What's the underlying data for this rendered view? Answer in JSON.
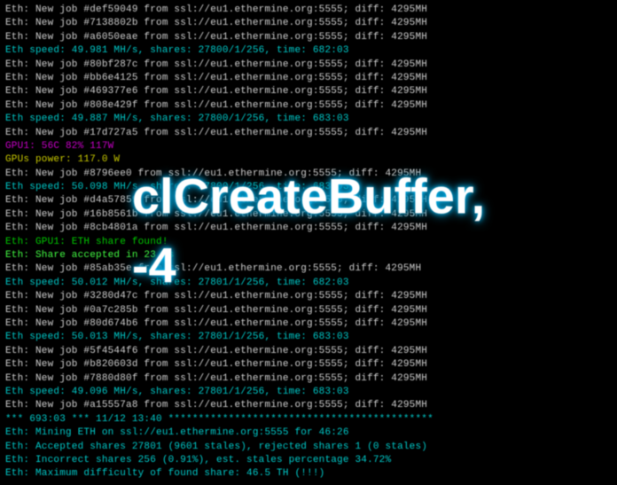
{
  "overlay_text": "clCreateBuffer, -4",
  "lines": [
    {
      "cls": "white",
      "text": "Eth: New job #def59049 from ssl://eu1.ethermine.org:5555; diff: 4295MH"
    },
    {
      "cls": "white",
      "text": "Eth: New job #7138802b from ssl://eu1.ethermine.org:5555; diff: 4295MH"
    },
    {
      "cls": "white",
      "text": "Eth: New job #a6050eae from ssl://eu1.ethermine.org:5555; diff: 4295MH"
    },
    {
      "cls": "cyan",
      "text": "Eth speed: 49.981 MH/s, shares: 27800/1/256, time: 682:03"
    },
    {
      "cls": "white",
      "text": "Eth: New job #80bf287c from ssl://eu1.ethermine.org:5555; diff: 4295MH"
    },
    {
      "cls": "white",
      "text": "Eth: New job #bb6e4125 from ssl://eu1.ethermine.org:5555; diff: 4295MH"
    },
    {
      "cls": "white",
      "text": "Eth: New job #469377e6 from ssl://eu1.ethermine.org:5555; diff: 4295MH"
    },
    {
      "cls": "white",
      "text": "Eth: New job #808e429f from ssl://eu1.ethermine.org:5555; diff: 4295MH"
    },
    {
      "cls": "cyan",
      "text": "Eth speed: 49.887 MH/s, shares: 27800/1/256, time: 683:03"
    },
    {
      "cls": "white",
      "text": "Eth: New job #17d727a5 from ssl://eu1.ethermine.org:5555; diff: 4295MH"
    },
    {
      "cls": "magenta",
      "text": "GPU1: 56C 82% 117W"
    },
    {
      "cls": "yellow",
      "text": "GPUs power: 117.0 W"
    },
    {
      "cls": "white",
      "text": "Eth: New job #8796ee0 from ssl://eu1.ethermine.org:5555; diff: 4295MH"
    },
    {
      "cls": "cyan",
      "text": "Eth speed: 50.098 MH/s, shares: 27800/1/256, time: 683:03"
    },
    {
      "cls": "white",
      "text": "Eth: New job #d4a57859 from ssl://eu1.ethermine.org:5555; diff: 4295MH"
    },
    {
      "cls": "white",
      "text": "Eth: New job #16b8561b from ssl://eu1.ethermine.org:5555; diff: 4295MH"
    },
    {
      "cls": "white",
      "text": "Eth: New job #8cb4801a from ssl://eu1.ethermine.org:5555; diff: 4295MH"
    },
    {
      "cls": "green",
      "text": "Eth: GPU1: ETH share found!"
    },
    {
      "cls": "bright-green",
      "text": "Eth: Share accepted in 23 ms"
    },
    {
      "cls": "white",
      "text": "Eth: New job #85ab35e from ssl://eu1.ethermine.org:5555; diff: 4295MH"
    },
    {
      "cls": "cyan",
      "text": "Eth speed: 50.012 MH/s, shares: 27801/1/256, time: 682:03"
    },
    {
      "cls": "white",
      "text": "Eth: New job #3280d47c from ssl://eu1.ethermine.org:5555; diff: 4295MH"
    },
    {
      "cls": "white",
      "text": "Eth: New job #0a7c285b from ssl://eu1.ethermine.org:5555; diff: 4295MH"
    },
    {
      "cls": "white",
      "text": "Eth: New job #80d674b6 from ssl://eu1.ethermine.org:5555; diff: 4295MH"
    },
    {
      "cls": "cyan",
      "text": "Eth speed: 50.013 MH/s, shares: 27801/1/256, time: 683:03"
    },
    {
      "cls": "white",
      "text": "Eth: New job #5f4544f6 from ssl://eu1.ethermine.org:5555; diff: 4295MH"
    },
    {
      "cls": "white",
      "text": "Eth: New job #b820603d from ssl://eu1.ethermine.org:5555; diff: 4295MH"
    },
    {
      "cls": "white",
      "text": "Eth: New job #7880d80f from ssl://eu1.ethermine.org:5555; diff: 4295MH"
    },
    {
      "cls": "cyan",
      "text": "Eth speed: 49.096 MH/s, shares: 27801/1/256, time: 683:03"
    },
    {
      "cls": "white",
      "text": "Eth: New job #a15557a8 from ssl://eu1.ethermine.org:5555; diff: 4295MH"
    },
    {
      "cls": "white",
      "text": ""
    },
    {
      "cls": "cyan",
      "text": "*** 693:03 *** 11/12 13:40 ********************************************"
    },
    {
      "cls": "cyan",
      "text": "Eth: Mining ETH on ssl://eu1.ethermine.org:5555 for 46:26"
    },
    {
      "cls": "cyan",
      "text": "Eth: Accepted shares 27801 (9601 stales), rejected shares 1 (0 stales)"
    },
    {
      "cls": "cyan",
      "text": "Eth: Incorrect shares 256 (0.91%), est. stales percentage 34.72%"
    },
    {
      "cls": "cyan",
      "text": "Eth: Maximum difficulty of found share: 46.5 TH (!!!)"
    }
  ]
}
